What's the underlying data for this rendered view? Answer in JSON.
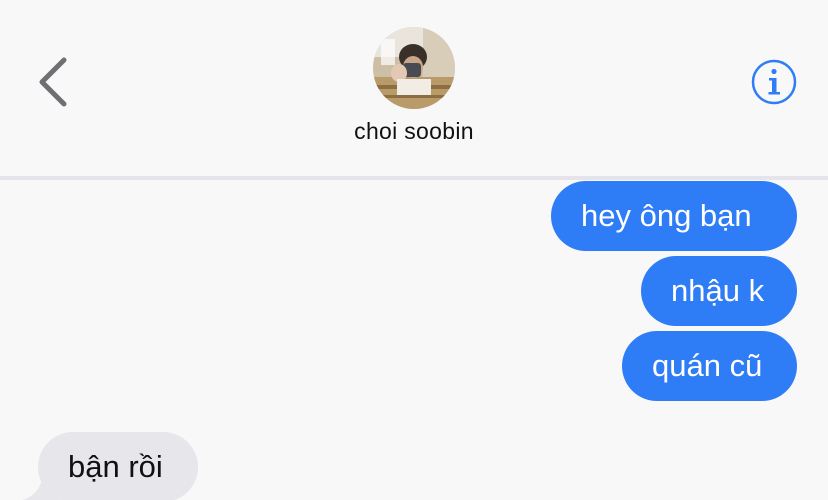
{
  "header": {
    "contact_name": "choi soobin",
    "back_icon": "chevron-left-icon",
    "info_icon": "info-circle-icon"
  },
  "colors": {
    "sent_bubble": "#2f7df6",
    "received_bubble": "#e6e6eb",
    "accent": "#2f7df6",
    "background": "#f8f8f9"
  },
  "messages": [
    {
      "direction": "sent",
      "text": "hey ông bạn"
    },
    {
      "direction": "sent",
      "text": "nhậu k"
    },
    {
      "direction": "sent",
      "text": "quán cũ"
    },
    {
      "direction": "received",
      "text": "bận rồi"
    }
  ]
}
